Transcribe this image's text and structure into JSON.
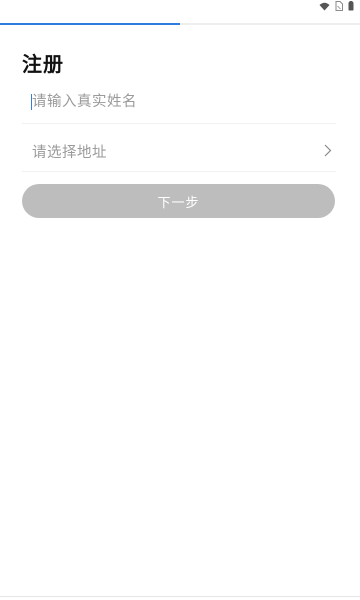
{
  "status_bar": {
    "icons": [
      "wifi-icon",
      "sim-icon",
      "battery-icon"
    ]
  },
  "progress": {
    "fraction": 0.5,
    "color": "#2b7de0"
  },
  "page": {
    "title": "注册"
  },
  "form": {
    "name_field": {
      "placeholder": "请输入真实姓名",
      "value": ""
    },
    "address_field": {
      "label": "请选择地址",
      "icon": "chevron-right-icon"
    },
    "next_button": {
      "label": "下一步",
      "background": "#bdbdbd"
    }
  }
}
